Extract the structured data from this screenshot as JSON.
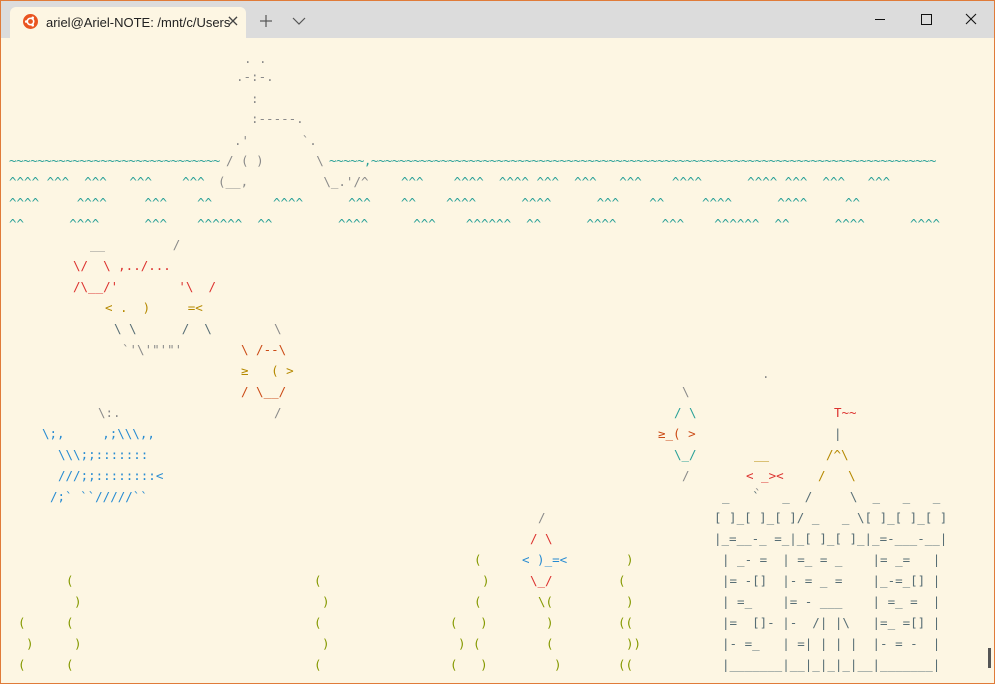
{
  "window": {
    "tab_title": "ariel@Ariel-NOTE: /mnt/c/Users",
    "tab_close_icon": "×",
    "minimize_icon": "minimize-icon",
    "maximize_icon": "maximize-icon",
    "close_icon": "close-icon"
  },
  "colors": {
    "background": "#fdf6e3",
    "titlebar": "#dcdcdc",
    "border": "#e07b39",
    "ubuntu": "#e95420"
  },
  "terminal": {
    "whale": [
      ". .",
      ".-:-.",
      ":",
      ":-----.",
      ".'       `.",
      "/ ( )       \\",
      "(__,          \\_.'/^"
    ],
    "waves": [
      "~~~~~~~~~~~~~~~~~~~~~~~~~~~~~~",
      "~~~~~,~~~~~~~~~~~~~~~~~~~~~~~~~~~~~~~~~~~~~~~~~~~~~~~~~~~~~~~~~~~~~~~~~~~~~~~~~~~~~~~~~",
      "^^^^ ^^^  ^^^   ^^^    ^^^",
      "^^^    ^^^^  ^^^^ ^^^  ^^^   ^^^    ^^^^      ^^^^ ^^^  ^^^   ^^^",
      "^^^^     ^^^^     ^^^    ^^",
      "^^^^      ^^^    ^^    ^^^^      ^^^^      ^^^    ^^     ^^^^      ^^^^     ^^",
      "^^      ^^^^      ^^^    ^^^^^^  ^^",
      "^^^^      ^^^    ^^^^^^  ^^      ^^^^      ^^^    ^^^^^^  ^^      ^^^^      ^^^^"
    ],
    "fish1": [
      "__         /",
      "\\/  \\ ,../...",
      "/\\__/'        '\\  /",
      "< .  )     =<",
      "\\ \\      /  \\",
      "`'\\'\"'\"'"
    ],
    "fish2": [
      "\\",
      "\\ /--\\",
      "≥   ( >",
      "/ \\__/",
      "/"
    ],
    "fish3": [
      "\\",
      "/ \\",
      "≥_( >",
      "\\_/",
      "/"
    ],
    "fish4": [
      "/",
      "/ \\",
      "< )_=<",
      "\\_/",
      "\\("
    ],
    "small_fish": [
      "__",
      "< _><",
      "`"
    ],
    "swordfish": [
      "\\:.",
      "\\;,     ,;\\\\\\,,",
      "\\\\\\;;:::::::",
      "///;;::::::::<",
      "/;` ``/////``"
    ],
    "castle": [
      "T~~",
      "|",
      "/^\\",
      "/   \\",
      "_   `   _  /     \\  _   _   _",
      "[ ]_[ ]_[ ]/ _   _ \\[ ]_[ ]_[ ]",
      "|_=__-_ =_|_[ ]_[ ]_|_=-___-__|",
      "| _- =  | =_ = _    |= _=   |",
      "|= -[]  |- = _ =    |_-=_[] |",
      "| =_    |= - ___    | =_ =  |",
      "|=  []- |-  /| |\\   |=_ =[] |",
      "|- =_   | =| | | |  |- = -  |",
      "|_______|__|_|_|_|__|_______|"
    ],
    "dot": "."
  }
}
